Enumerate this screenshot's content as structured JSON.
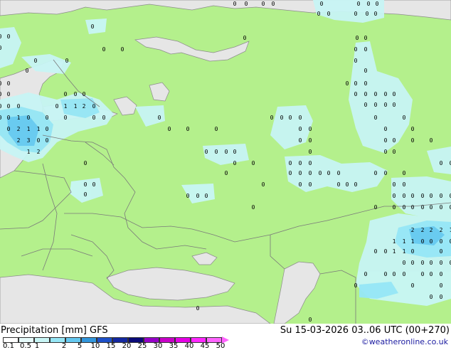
{
  "map": {
    "colors": {
      "land": "#b4f08c",
      "nonland": "#e6e6e6",
      "border": "#7a7a7a",
      "coast": "#8c8c8c",
      "precip_light": "#c8f5f5",
      "precip_mid": "#96e6f5",
      "precip_heavy": "#64c8f0"
    },
    "precip_value_labels": [
      "0",
      "1",
      "2",
      "3",
      "5"
    ]
  },
  "footer": {
    "title": "Precipitation [mm]  GFS",
    "valid_time": "Su 15-03-2026 03..06 UTC (00+270)",
    "credit": "©weatheronline.co.uk"
  },
  "legend": {
    "labels": [
      "0.1",
      "0.5",
      "1",
      "2",
      "5",
      "10",
      "15",
      "20",
      "25",
      "30",
      "35",
      "40",
      "45",
      "50"
    ],
    "colors": [
      "#ffffff",
      "#e6fafa",
      "#c8f5f5",
      "#96e6f5",
      "#64c8f0",
      "#3296dc",
      "#1e50c8",
      "#1428a0",
      "#0a0a78",
      "#9600c8",
      "#c800c8",
      "#e600e6",
      "#ff28ff",
      "#ff64ff"
    ]
  }
}
